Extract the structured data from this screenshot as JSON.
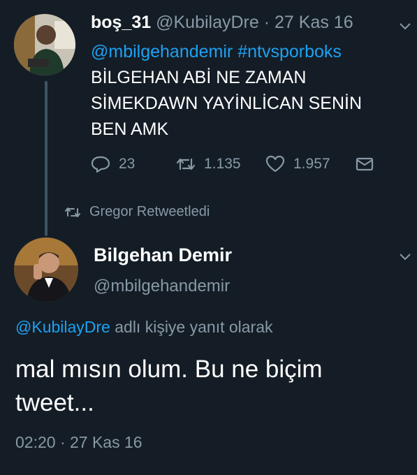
{
  "tweet1": {
    "display_name": "boş_31",
    "handle": "@KubilayDre",
    "separator": "·",
    "date": "27 Kas 16",
    "mention": "@mbilgehandemir",
    "hashtag": "#ntvsporboks",
    "text": "BİLGEHAN ABİ NE ZAMAN\nSİMEKDAWN YAYİNLİCAN SENİN\nBEN AMK",
    "replies": "23",
    "retweets": "1.135",
    "likes": "1.957"
  },
  "retweet_notice": "Gregor Retweetledi",
  "tweet2": {
    "display_name": "Bilgehan Demir",
    "handle": "@mbilgehandemir",
    "reply_to_mention": "@KubilayDre",
    "reply_to_suffix": "adlı kişiye yanıt olarak",
    "text": "mal mısın olum. Bu ne biçim\ntweet...",
    "timestamp": "02:20 · 27 Kas 16"
  },
  "colors": {
    "background": "#141d26",
    "accent": "#1da1f2",
    "muted": "#8899a6",
    "text": "#ffffff"
  },
  "icons": {
    "reply": "reply-icon",
    "retweet": "retweet-icon",
    "like": "heart-icon",
    "dm": "envelope-icon",
    "menu": "chevron-down-icon"
  }
}
